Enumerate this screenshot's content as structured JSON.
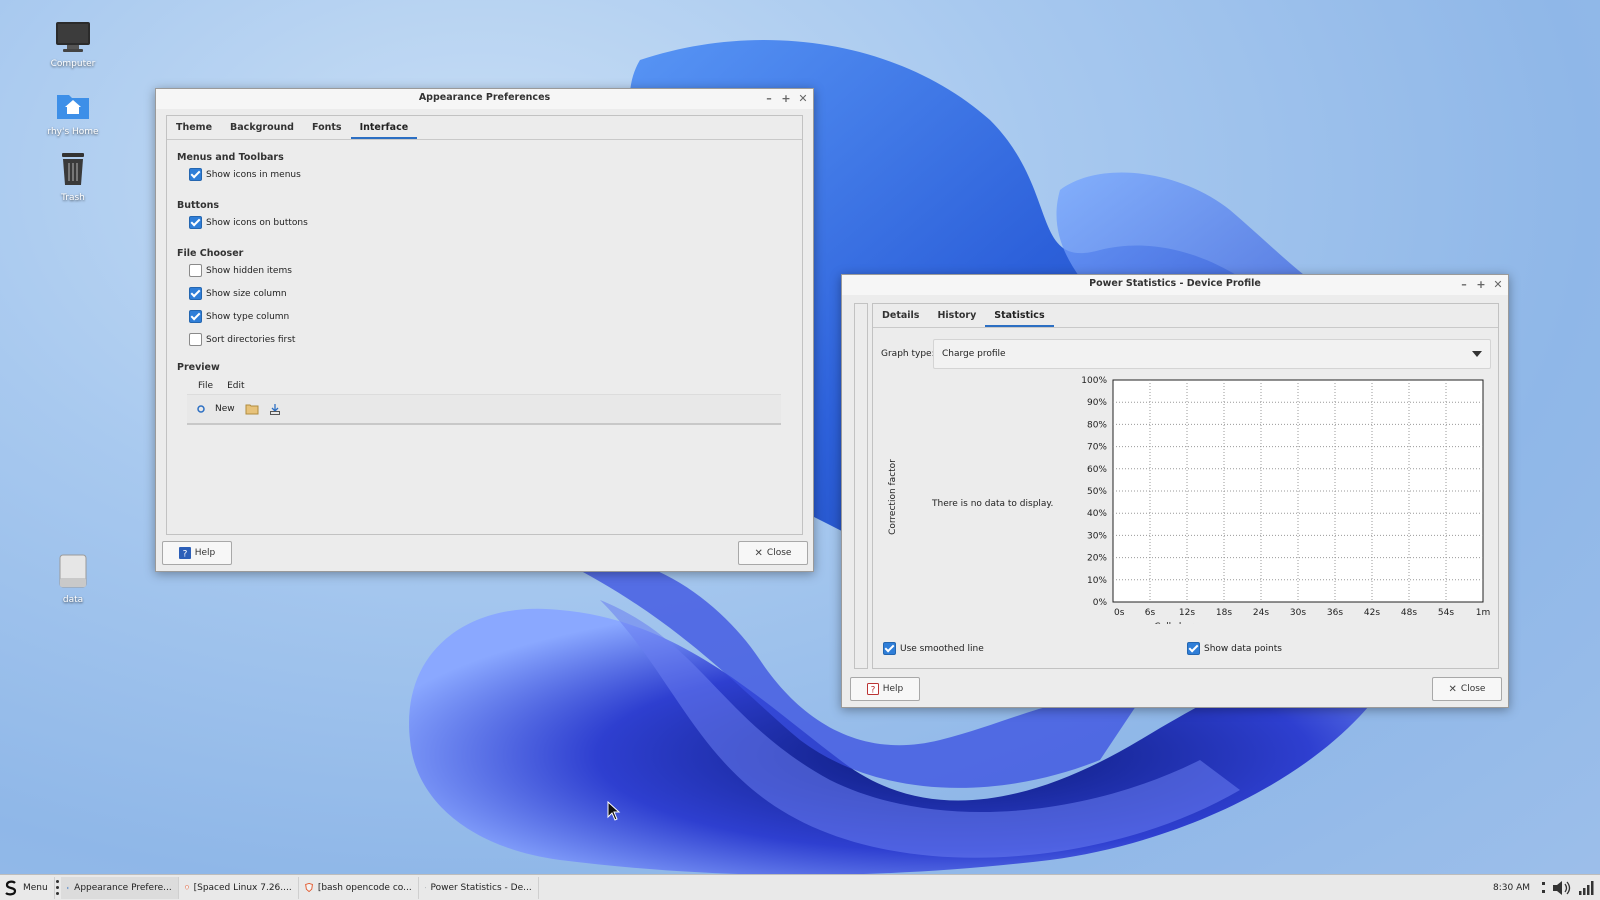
{
  "desktop": {
    "icons": [
      {
        "label": "Computer",
        "icon": "monitor-icon"
      },
      {
        "label": "rhy's Home",
        "icon": "home-folder-icon"
      },
      {
        "label": "Trash",
        "icon": "trash-icon"
      },
      {
        "label": "data",
        "icon": "drive-icon"
      }
    ]
  },
  "appearance": {
    "title": "Appearance Preferences",
    "tabs": [
      "Theme",
      "Background",
      "Fonts",
      "Interface"
    ],
    "active_tab": "Interface",
    "sections": {
      "menus": {
        "title": "Menus and Toolbars",
        "items": [
          {
            "label": "Show icons in menus",
            "checked": true
          }
        ]
      },
      "buttons": {
        "title": "Buttons",
        "items": [
          {
            "label": "Show icons on buttons",
            "checked": true
          }
        ]
      },
      "file_chooser": {
        "title": "File Chooser",
        "items": [
          {
            "label": "Show hidden items",
            "checked": false
          },
          {
            "label": "Show size column",
            "checked": true
          },
          {
            "label": "Show type column",
            "checked": true
          },
          {
            "label": "Sort directories first",
            "checked": false
          }
        ]
      },
      "preview": {
        "title": "Preview",
        "menu": [
          "File",
          "Edit"
        ],
        "toolbar_new": "New"
      }
    },
    "help_label": "Help",
    "close_label": "Close"
  },
  "power": {
    "title": "Power Statistics - Device Profile",
    "tabs": [
      "Details",
      "History",
      "Statistics"
    ],
    "active_tab": "Statistics",
    "graph_type_label": "Graph type:",
    "graph_type_value": "Charge profile",
    "no_data": "There is no data to display.",
    "smoothed_label": "Use smoothed line",
    "smoothed_checked": true,
    "points_label": "Show data points",
    "points_checked": true,
    "help_label": "Help",
    "close_label": "Close"
  },
  "chart_data": {
    "type": "line",
    "title": "",
    "xlabel": "Cell charge",
    "ylabel": "Correction factor",
    "x_ticks": [
      "0s",
      "6s",
      "12s",
      "18s",
      "24s",
      "30s",
      "36s",
      "42s",
      "48s",
      "54s",
      "1m"
    ],
    "y_ticks": [
      "0%",
      "10%",
      "20%",
      "30%",
      "40%",
      "50%",
      "60%",
      "70%",
      "80%",
      "90%",
      "100%"
    ],
    "ylim": [
      0,
      100
    ],
    "grid": true,
    "series": []
  },
  "taskbar": {
    "menu_label": "Menu",
    "items": [
      {
        "label": "Appearance Prefere...",
        "icon": "appearance-app-icon"
      },
      {
        "label": "[Spaced Linux 7.26....",
        "icon": "browser-shield-icon"
      },
      {
        "label": "[bash opencode co...",
        "icon": "browser-shield-icon"
      },
      {
        "label": "Power Statistics - De...",
        "icon": "power-stats-app-icon"
      }
    ],
    "clock": "8:30 AM"
  }
}
